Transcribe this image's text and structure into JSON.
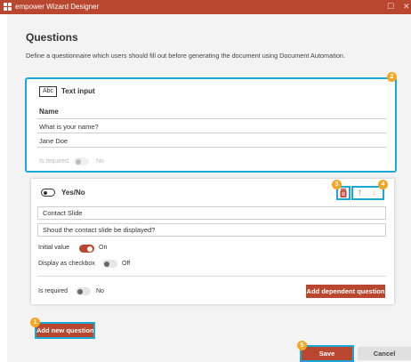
{
  "window": {
    "title": "empower Wizard Designer",
    "restore_glyph": "☐",
    "close_glyph": "✕"
  },
  "header": {
    "title": "Questions",
    "description": "Define a questionnaire which users should fill out before generating the document using Document Automation."
  },
  "question_text": {
    "type_icon_text": "Abc",
    "type_label": "Text input",
    "name": "Name",
    "question": "What is your name?",
    "default_value": "Jane Doe",
    "is_required_label": "Is required",
    "is_required_state": "No"
  },
  "question_yesno": {
    "type_label": "Yes/No",
    "name": "Contact Slide",
    "question": "Shoud the contact slide be displayed?",
    "initial_value_label": "Initial value",
    "initial_value_state": "On",
    "display_checkbox_label": "Display as checkbox",
    "display_checkbox_state": "Off",
    "is_required_label": "Is required",
    "is_required_state": "No",
    "add_dependent_label": "Add dependent question",
    "move_up_glyph": "↑",
    "move_down_glyph": "↓"
  },
  "footer": {
    "add_question_label": "Add new question",
    "save_label": "Save",
    "cancel_label": "Cancel"
  },
  "badges": [
    "1",
    "2",
    "3",
    "4",
    "5"
  ],
  "colors": {
    "accent": "#b9462f",
    "highlight": "#19a8d8",
    "badge": "#f5a623"
  },
  "icons": [
    "empower-logo-icon",
    "restore-icon",
    "close-icon",
    "text-input-icon",
    "toggle-icon",
    "delete-icon",
    "arrow-up-icon",
    "arrow-down-icon"
  ]
}
